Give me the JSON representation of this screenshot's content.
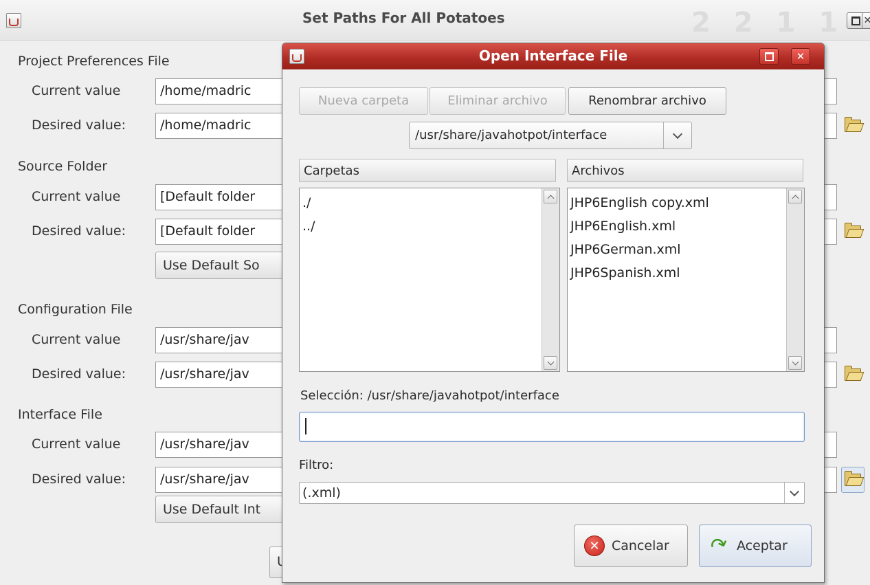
{
  "main_window": {
    "title": "Set Paths For All Potatoes",
    "ghost_text": "2 2 1 1",
    "sections": [
      {
        "label": "Project Preferences File",
        "current_label": "Current value",
        "current_value": "/home/madric",
        "desired_label": "Desired value:",
        "desired_value": "/home/madric"
      },
      {
        "label": "Source Folder",
        "current_label": "Current value",
        "current_value": "[Default folder",
        "desired_label": "Desired value:",
        "desired_value": "[Default folder",
        "button_label": "Use Default So"
      },
      {
        "label": "Configuration File",
        "current_label": "Current value",
        "current_value": "/usr/share/jav",
        "desired_label": "Desired value:",
        "desired_value": "/usr/share/jav"
      },
      {
        "label": "Interface File",
        "current_label": "Current value",
        "current_value": "/usr/share/jav",
        "desired_label": "Desired value:",
        "desired_value": "/usr/share/jav",
        "button_label": "Use Default Int"
      }
    ],
    "bottom_button_partial": "U"
  },
  "dialog": {
    "title": "Open Interface File",
    "toolbar": {
      "new_folder": "Nueva carpeta",
      "delete_file": "Eliminar archivo",
      "rename_file": "Renombrar archivo"
    },
    "path_combo": "/usr/share/javahotpot/interface",
    "folders_header": "Carpetas",
    "files_header": "Archivos",
    "folders": [
      "./",
      "../"
    ],
    "files": [
      "JHP6English copy.xml",
      "JHP6English.xml",
      "JHP6German.xml",
      "JHP6Spanish.xml"
    ],
    "selection_label": "Selección:",
    "selection_path": "/usr/share/javahotpot/interface",
    "selection_input": "",
    "filter_label": "Filtro:",
    "filter_value": "(.xml)",
    "cancel_label": "Cancelar",
    "accept_label": "Aceptar"
  }
}
